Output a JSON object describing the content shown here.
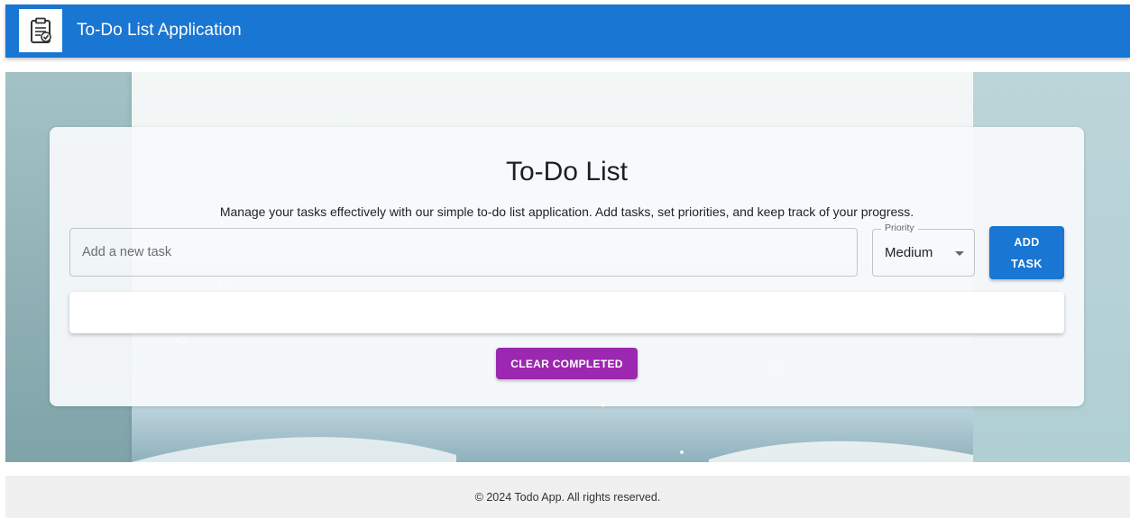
{
  "appbar": {
    "title": "To-Do List Application",
    "logo_icon": "clipboard-check-icon",
    "background": "#1976d2"
  },
  "main": {
    "title": "To-Do List",
    "description": "Manage your tasks effectively with our simple to-do list application. Add tasks, set priorities, and keep track of your progress.",
    "task_input": {
      "placeholder": "Add a new task",
      "value": ""
    },
    "priority": {
      "label": "Priority",
      "value": "Medium",
      "icon": "chevron-down-icon"
    },
    "add_button": {
      "line1": "ADD",
      "line2": "TASK",
      "color": "#1976d2"
    },
    "tasks": [],
    "clear_button": {
      "label": "CLEAR COMPLETED",
      "color": "#9c27b0"
    }
  },
  "footer": {
    "text": "© 2024 Todo App. All rights reserved."
  }
}
